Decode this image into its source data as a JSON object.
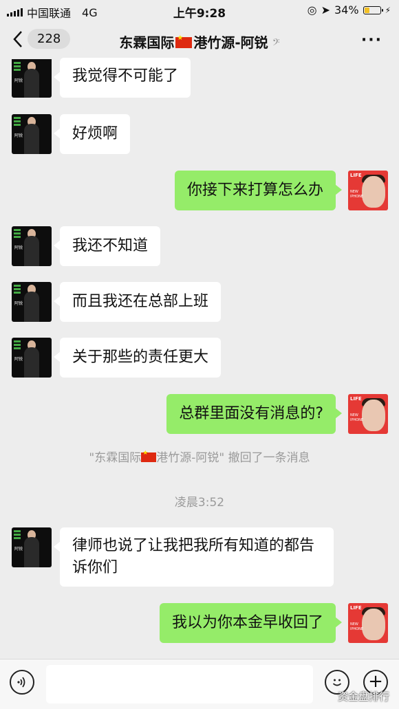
{
  "status_bar": {
    "carrier": "中国联通",
    "network": "4G",
    "time": "上午9:28",
    "battery": "34%"
  },
  "nav": {
    "back_count": "228",
    "title_part1": "东霖国际",
    "title_part2": "港竹源-阿锐"
  },
  "messages": [
    {
      "side": "left",
      "text": "我觉得不可能了"
    },
    {
      "side": "left",
      "text": "好烦啊"
    },
    {
      "side": "right",
      "text": "你接下来打算怎么办"
    },
    {
      "side": "left",
      "text": "我还不知道"
    },
    {
      "side": "left",
      "text": "而且我还在总部上班"
    },
    {
      "side": "left",
      "text": "关于那些的责任更大"
    },
    {
      "side": "right",
      "text": "总群里面没有消息的?"
    },
    {
      "side": "left",
      "text": "律师也说了让我把我所有知道的都告诉你们"
    },
    {
      "side": "right",
      "text": "我以为你本金早收回了"
    }
  ],
  "system": {
    "recall_part1": "\"东霖国际",
    "recall_part2": "港竹源-阿锐\" 撤回了一条消息",
    "timestamp": "凌晨3:52"
  },
  "avatar_right": {
    "life": "LIFE",
    "line1": "NEW",
    "line2": "IPHONE"
  },
  "avatar_left": {
    "tag": "阿锐"
  },
  "watermark": "资金盘排行",
  "colors": {
    "chat_bg": "#ededed",
    "bubble_sent": "#95ec69",
    "bubble_received": "#ffffff",
    "meta_text": "#9a9a9a"
  }
}
